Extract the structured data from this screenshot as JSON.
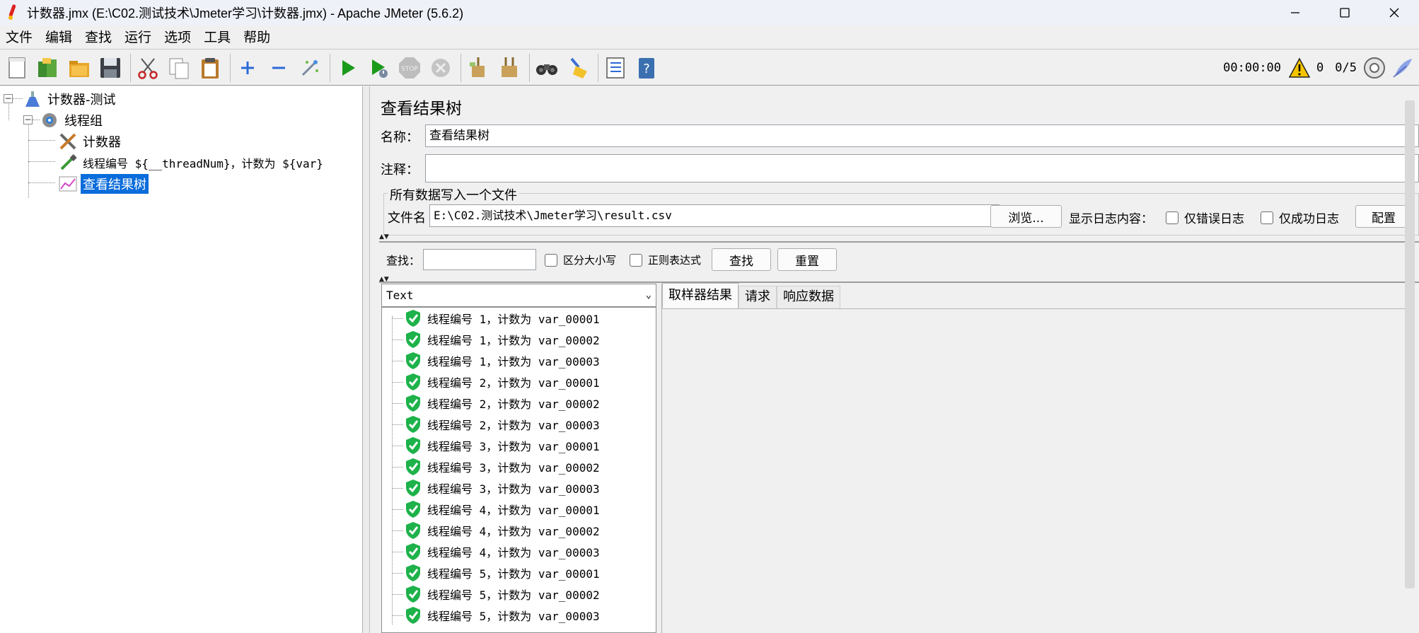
{
  "window": {
    "title": "计数器.jmx (E:\\C02.测试技术\\Jmeter学习\\计数器.jmx) - Apache JMeter (5.6.2)",
    "minimize": "—",
    "maximize": "☐",
    "close": "✕"
  },
  "menu": [
    "文件",
    "编辑",
    "查找",
    "运行",
    "选项",
    "工具",
    "帮助"
  ],
  "toolbar": {
    "timer": "00:00:00",
    "warnings": "0",
    "threads": "0/5"
  },
  "tree": {
    "root": "计数器-测试",
    "thread_group": "线程组",
    "counter": "计数器",
    "sampler": "线程编号 ${__threadNum}，计数为 ${var}",
    "listener": "查看结果树"
  },
  "panel": {
    "title": "查看结果树",
    "name_label": "名称：",
    "name_value": "查看结果树",
    "comment_label": "注释：",
    "comment_value": "",
    "file_group_title": "所有数据写入一个文件",
    "filename_label": "文件名",
    "filename_value": "E:\\C02.测试技术\\Jmeter学习\\result.csv",
    "browse_button": "浏览...",
    "log_display_label": "显示日志内容：",
    "errors_only": "仅错误日志",
    "success_only": "仅成功日志",
    "config_button": "配置"
  },
  "search": {
    "label": "查找：",
    "value": "",
    "case_sensitive": "区分大小写",
    "regex": "正则表达式",
    "find_button": "查找",
    "reset_button": "重置"
  },
  "renderer": {
    "selected": "Text"
  },
  "results": [
    "线程编号 1，计数为 var_00001",
    "线程编号 1，计数为 var_00002",
    "线程编号 1，计数为 var_00003",
    "线程编号 2，计数为 var_00001",
    "线程编号 2，计数为 var_00002",
    "线程编号 2，计数为 var_00003",
    "线程编号 3，计数为 var_00001",
    "线程编号 3，计数为 var_00002",
    "线程编号 3，计数为 var_00003",
    "线程编号 4，计数为 var_00001",
    "线程编号 4，计数为 var_00002",
    "线程编号 4，计数为 var_00003",
    "线程编号 5，计数为 var_00001",
    "线程编号 5，计数为 var_00002",
    "线程编号 5，计数为 var_00003"
  ],
  "tabs": [
    "取样器结果",
    "请求",
    "响应数据"
  ],
  "icons": {
    "new": "new-file-icon",
    "templates": "templates-icon",
    "open": "open-folder-icon",
    "save": "save-disk-icon",
    "cut": "scissors-icon",
    "copy": "copy-icon",
    "paste": "paste-icon",
    "expand": "plus-icon",
    "collapse": "minus-icon",
    "toggle": "toggle-wand-icon",
    "start": "play-icon",
    "start_no_pause": "play-no-timer-icon",
    "stop": "stop-icon",
    "shutdown": "shutdown-icon",
    "clear": "broom-icon",
    "clear_all": "broom-all-icon",
    "search": "binoculars-icon",
    "reset_search": "reset-brush-icon",
    "function_helper": "function-list-icon",
    "help": "help-book-icon"
  },
  "colors": {
    "selection": "#0b6cdb",
    "success": "#1db24a",
    "play": "#1a9a1a"
  }
}
